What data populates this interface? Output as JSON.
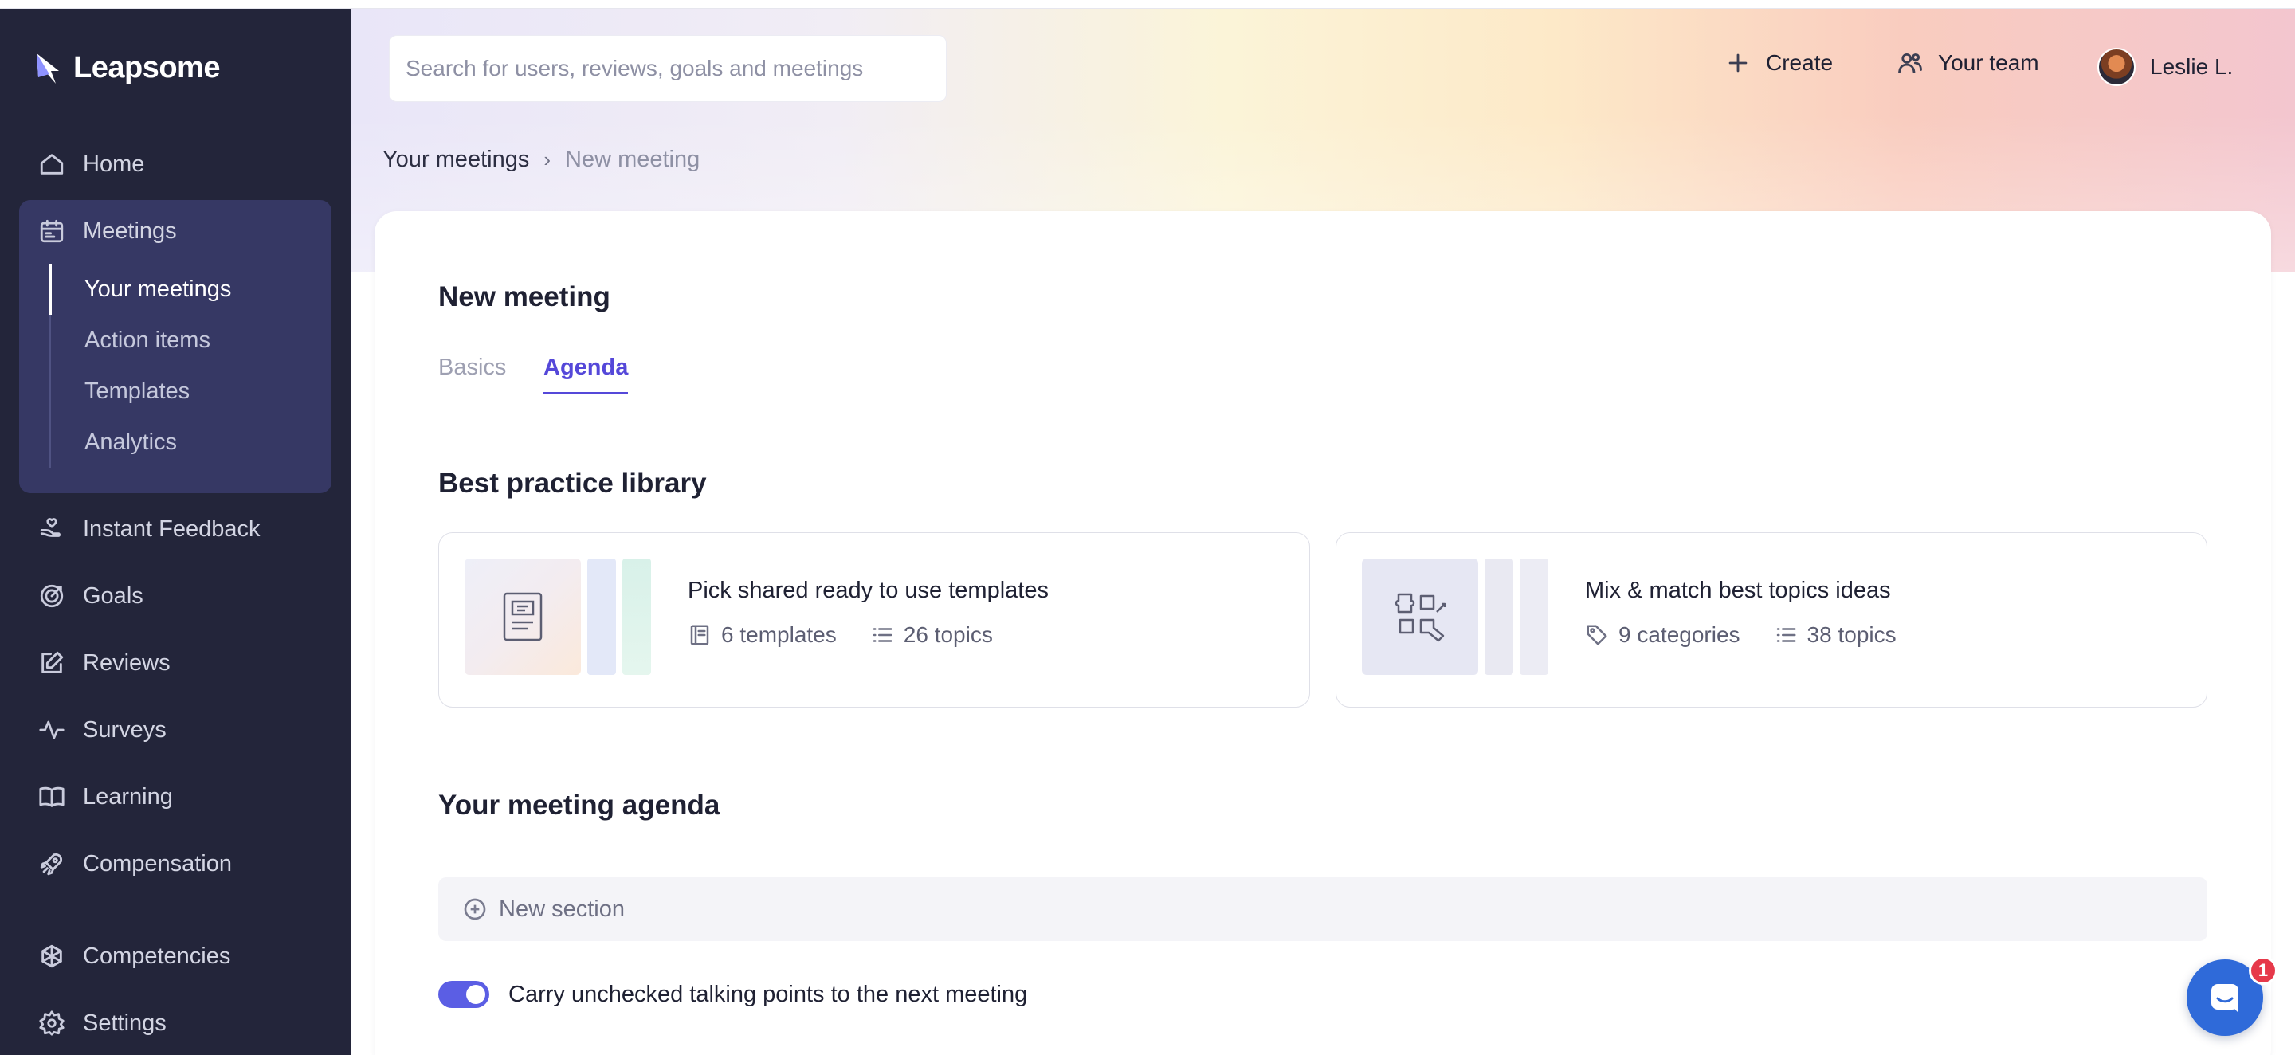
{
  "app": {
    "brand": "Leapsome"
  },
  "search": {
    "placeholder": "Search for users, reviews, goals and meetings"
  },
  "topbar": {
    "create_label": "Create",
    "team_label": "Your team",
    "user_name": "Leslie L."
  },
  "sidebar": {
    "items": [
      {
        "label": "Home",
        "icon": "home-icon"
      },
      {
        "label": "Meetings",
        "icon": "meetings-icon"
      },
      {
        "label": "Instant Feedback",
        "icon": "feedback-icon"
      },
      {
        "label": "Goals",
        "icon": "goals-icon"
      },
      {
        "label": "Reviews",
        "icon": "reviews-icon"
      },
      {
        "label": "Surveys",
        "icon": "surveys-icon"
      },
      {
        "label": "Learning",
        "icon": "learning-icon"
      },
      {
        "label": "Compensation",
        "icon": "compensation-icon"
      },
      {
        "label": "Competencies",
        "icon": "competencies-icon"
      },
      {
        "label": "Settings",
        "icon": "settings-icon"
      }
    ],
    "meetings_sub": [
      {
        "label": "Your meetings",
        "active": true
      },
      {
        "label": "Action items",
        "active": false
      },
      {
        "label": "Templates",
        "active": false
      },
      {
        "label": "Analytics",
        "active": false
      }
    ]
  },
  "breadcrumb": {
    "parent": "Your meetings",
    "separator": "›",
    "current": "New meeting"
  },
  "main": {
    "title": "New meeting",
    "tabs": [
      {
        "label": "Basics",
        "active": false
      },
      {
        "label": "Agenda",
        "active": true
      }
    ],
    "library": {
      "heading": "Best practice library",
      "cards": [
        {
          "title": "Pick shared ready to use templates",
          "count1": "6 templates",
          "count2": "26 topics"
        },
        {
          "title": "Mix & match best topics ideas",
          "count1": "9 categories",
          "count2": "38 topics"
        }
      ]
    },
    "agenda": {
      "heading": "Your meeting agenda",
      "new_section_label": "New section",
      "carry_over_label": "Carry unchecked talking points to the next meeting",
      "carry_over_enabled": true
    }
  },
  "chat": {
    "badge_count": "1"
  },
  "colors": {
    "accent": "#5548d9",
    "sidebar_bg": "#23253a",
    "toggle_on": "#5b5ee4",
    "chat": "#2f6ad9",
    "badge": "#e6394a"
  }
}
